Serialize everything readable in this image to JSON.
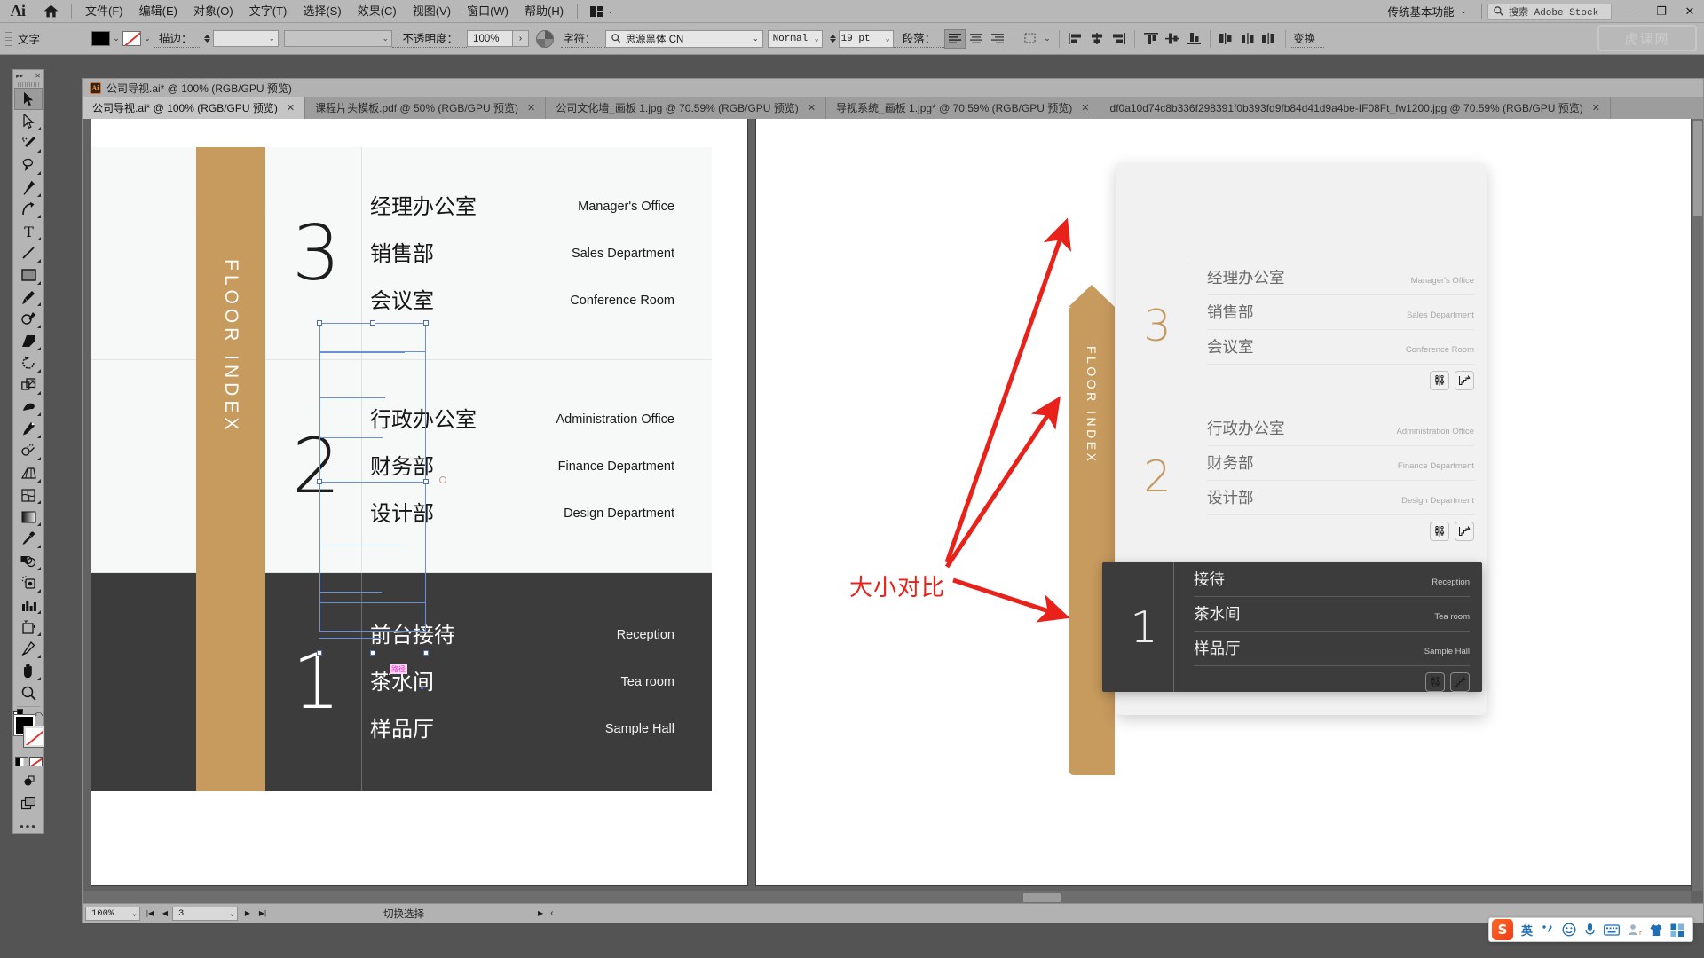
{
  "app": {
    "name": "Adobe Illustrator",
    "logo_text": "Ai",
    "workspace": "传统基本功能",
    "stock_search_placeholder": "搜索 Adobe Stock"
  },
  "menu": {
    "items": [
      {
        "label": "文件(F)"
      },
      {
        "label": "编辑(E)"
      },
      {
        "label": "对象(O)"
      },
      {
        "label": "文字(T)"
      },
      {
        "label": "选择(S)"
      },
      {
        "label": "效果(C)"
      },
      {
        "label": "视图(V)"
      },
      {
        "label": "窗口(W)"
      },
      {
        "label": "帮助(H)"
      }
    ]
  },
  "window_buttons": {
    "minimize": "—",
    "restore": "❐",
    "close": "✕"
  },
  "control_bar": {
    "context_label": "文字",
    "stroke_label": "描边：",
    "stroke_weight": "",
    "stroke_profile": "",
    "opacity_label": "不透明度：",
    "opacity_value": "100%",
    "char_label": "字符：",
    "font_family": "思源黑体 CN",
    "font_style": "Normal",
    "font_size": "19 pt",
    "paragraph_label": "段落：",
    "transform_label": "变换",
    "hk_logo_text": "虎课网"
  },
  "toolbar": {
    "tools": [
      {
        "name": "selection-tool",
        "selected": true
      },
      {
        "name": "direct-selection-tool",
        "selected": false
      },
      {
        "name": "magic-wand-tool",
        "selected": false
      },
      {
        "name": "lasso-tool",
        "selected": false
      },
      {
        "name": "pen-tool",
        "selected": false
      },
      {
        "name": "curvature-tool",
        "selected": false
      },
      {
        "name": "type-tool",
        "selected": false
      },
      {
        "name": "line-segment-tool",
        "selected": false
      },
      {
        "name": "rectangle-tool",
        "selected": false
      },
      {
        "name": "paintbrush-tool",
        "selected": false
      },
      {
        "name": "shaper-pencil-tool",
        "selected": false
      },
      {
        "name": "eraser-tool",
        "selected": false
      },
      {
        "name": "rotate-tool",
        "selected": false
      },
      {
        "name": "scale-tool",
        "selected": false
      },
      {
        "name": "width-warp-tool",
        "selected": false
      },
      {
        "name": "free-transform-tool",
        "selected": false
      },
      {
        "name": "shape-builder-tool",
        "selected": false
      },
      {
        "name": "perspective-grid-tool",
        "selected": false
      },
      {
        "name": "mesh-tool",
        "selected": false
      },
      {
        "name": "gradient-tool",
        "selected": false
      },
      {
        "name": "eyedropper-tool",
        "selected": false
      },
      {
        "name": "blend-tool",
        "selected": false
      },
      {
        "name": "symbol-sprayer-tool",
        "selected": false
      },
      {
        "name": "column-graph-tool",
        "selected": false
      },
      {
        "name": "artboard-tool",
        "selected": false
      },
      {
        "name": "slice-tool",
        "selected": false
      },
      {
        "name": "hand-tool",
        "selected": false
      },
      {
        "name": "zoom-tool",
        "selected": false
      }
    ],
    "more_tools": "•••"
  },
  "document": {
    "title": "公司导视.ai* @ 100% (RGB/GPU 预览)",
    "tabs": [
      {
        "label": "公司导视.ai* @ 100% (RGB/GPU 预览)",
        "active": true,
        "close": "✕"
      },
      {
        "label": "课程片头模板.pdf @ 50% (RGB/GPU 预览)",
        "active": false,
        "close": "✕"
      },
      {
        "label": "公司文化墙_画板 1.jpg @ 70.59% (RGB/GPU 预览)",
        "active": false,
        "close": "✕"
      },
      {
        "label": "导视系统_画板 1.jpg* @ 70.59% (RGB/GPU 预览)",
        "active": false,
        "close": "✕"
      },
      {
        "label": "df0a10d74c8b336f298391f0b393fd9fb84d41d9a4be-IF08Ft_fw1200.jpg @ 70.59% (RGB/GPU 预览)",
        "active": false,
        "close": "✕"
      }
    ]
  },
  "artwork": {
    "floor_index_label": "FLOOR INDEX",
    "floors": [
      {
        "number": "3",
        "dark": false,
        "rows": [
          {
            "cn": "经理办公室",
            "en": "Manager's Office"
          },
          {
            "cn": "销售部",
            "en": "Sales Department"
          },
          {
            "cn": "会议室",
            "en": "Conference Room"
          }
        ]
      },
      {
        "number": "2",
        "dark": false,
        "rows": [
          {
            "cn": "行政办公室",
            "en": "Administration Office"
          },
          {
            "cn": "财务部",
            "en": "Finance Department"
          },
          {
            "cn": "设计部",
            "en": "Design Department"
          }
        ]
      },
      {
        "number": "1",
        "dark": true,
        "rows": [
          {
            "cn": "前台接待",
            "en": "Reception"
          },
          {
            "cn": "茶水间",
            "en": "Tea room"
          },
          {
            "cn": "样品厅",
            "en": "Sample Hall"
          }
        ]
      }
    ],
    "smart_guide_label": "路径"
  },
  "reference": {
    "floor_index_label": "FLOOR INDEX",
    "annotation": "大小对比",
    "annotation_color": "#e8221a",
    "gold_color": "#c79a5e",
    "floors": [
      {
        "number": "3",
        "dark": false,
        "rows": [
          {
            "cn": "经理办公室",
            "en": "Manager's Office"
          },
          {
            "cn": "销售部",
            "en": "Sales Department"
          },
          {
            "cn": "会议室",
            "en": "Conference Room"
          }
        ]
      },
      {
        "number": "2",
        "dark": false,
        "rows": [
          {
            "cn": "行政办公室",
            "en": "Administration Office"
          },
          {
            "cn": "财务部",
            "en": "Finance Department"
          },
          {
            "cn": "设计部",
            "en": "Design Department"
          }
        ]
      },
      {
        "number": "1",
        "dark": true,
        "rows": [
          {
            "cn": "接待",
            "en": "Reception"
          },
          {
            "cn": "茶水间",
            "en": "Tea room"
          },
          {
            "cn": "样品厅",
            "en": "Sample Hall"
          }
        ]
      }
    ]
  },
  "status_bar": {
    "zoom": "100%",
    "artboard_number": "3",
    "message": "切换选择"
  },
  "ime": {
    "brand": "S",
    "mode": "英",
    "items": [
      "punctuation-icon",
      "emoji-icon",
      "microphone-icon",
      "soft-keyboard-icon",
      "user-icon",
      "skin-icon",
      "apps-icon"
    ]
  }
}
